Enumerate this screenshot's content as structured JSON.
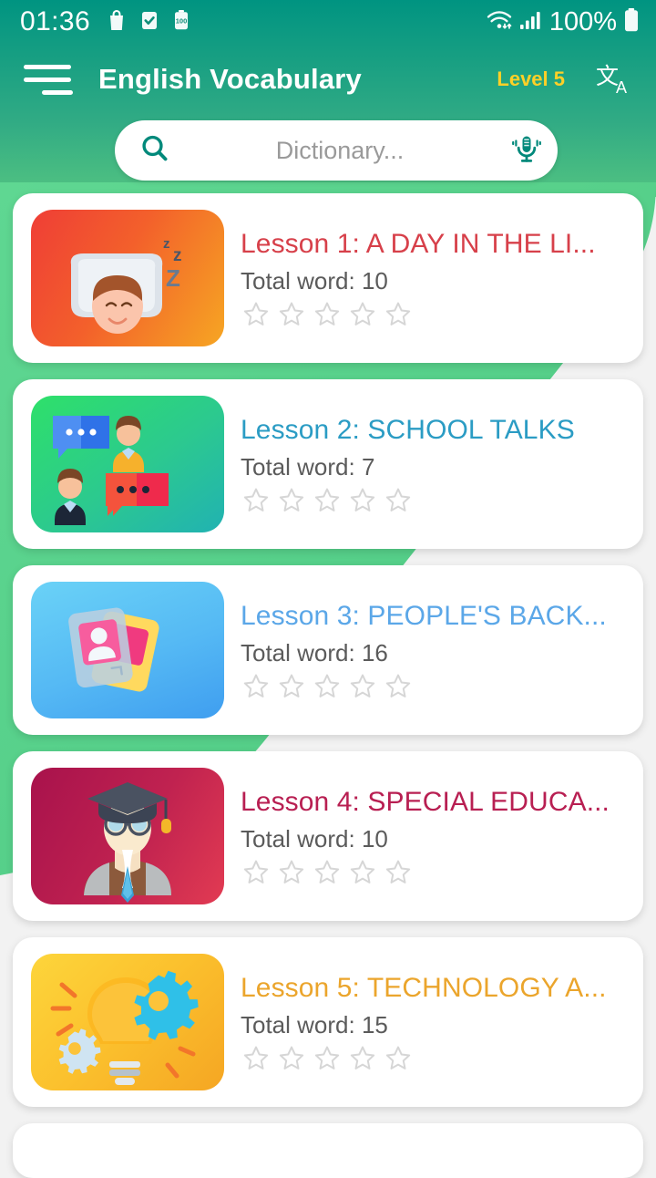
{
  "status_bar": {
    "time": "01:36",
    "battery_percent": "100%",
    "battery_icon_label": "100",
    "left_icons": [
      "shopping-bag-icon",
      "checkbox-checked-icon",
      "battery-saver-icon"
    ],
    "right_icons": [
      "wifi-icon",
      "cellular-signal-icon",
      "battery-icon"
    ],
    "text_color": "#ffffff"
  },
  "app_bar": {
    "menu_icon": "hamburger-menu-icon",
    "title": "English Vocabulary",
    "level_label": "Level 5",
    "level_color": "#ffd027",
    "translate_icon": "translate-icon"
  },
  "search": {
    "placeholder": "Dictionary...",
    "value": "",
    "search_icon": "search-icon",
    "mic_icon": "microphone-icon",
    "icon_color": "#008f7a"
  },
  "theme": {
    "header_gradient_start": "#009481",
    "header_gradient_end": "#4ec07a",
    "accent_green": "#5bd78c",
    "page_background": "#f2f2f2"
  },
  "lessons": [
    {
      "title": "Lesson 1: A DAY IN THE LI...",
      "total_word": "Total word: 10",
      "title_color": "#d7404a",
      "thumb_from": "#ef3e36",
      "thumb_to": "#f6a623",
      "thumb_icon": "sleeping-person-icon",
      "rating": 0,
      "stars_total": 5
    },
    {
      "title": "Lesson 2: SCHOOL TALKS",
      "total_word": "Total word: 7",
      "title_color": "#2b9cc4",
      "thumb_from": "#2ee06a",
      "thumb_to": "#21b2b2",
      "thumb_icon": "people-chat-icon",
      "rating": 0,
      "stars_total": 5
    },
    {
      "title": "Lesson 3: PEOPLE'S BACK...",
      "total_word": "Total word: 16",
      "title_color": "#5ba7e8",
      "thumb_from": "#62cdf5",
      "thumb_to": "#3f9ef0",
      "thumb_icon": "id-cards-icon",
      "rating": 0,
      "stars_total": 5
    },
    {
      "title": "Lesson 4: SPECIAL EDUCA...",
      "total_word": "Total word: 10",
      "title_color": "#b81f52",
      "thumb_from": "#a8124c",
      "thumb_to": "#e23b52",
      "thumb_icon": "professor-icon",
      "rating": 0,
      "stars_total": 5
    },
    {
      "title": "Lesson 5: TECHNOLOGY A...",
      "total_word": "Total word: 15",
      "title_color": "#eba52c",
      "thumb_from": "#fdd53b",
      "thumb_to": "#f5a623",
      "thumb_icon": "lightbulb-gears-icon",
      "rating": 0,
      "stars_total": 5
    },
    {
      "title": "",
      "total_word": "",
      "title_color": "#888888",
      "thumb_from": "#ffffff",
      "thumb_to": "#ffffff",
      "thumb_icon": "",
      "rating": 0,
      "stars_total": 5
    }
  ]
}
